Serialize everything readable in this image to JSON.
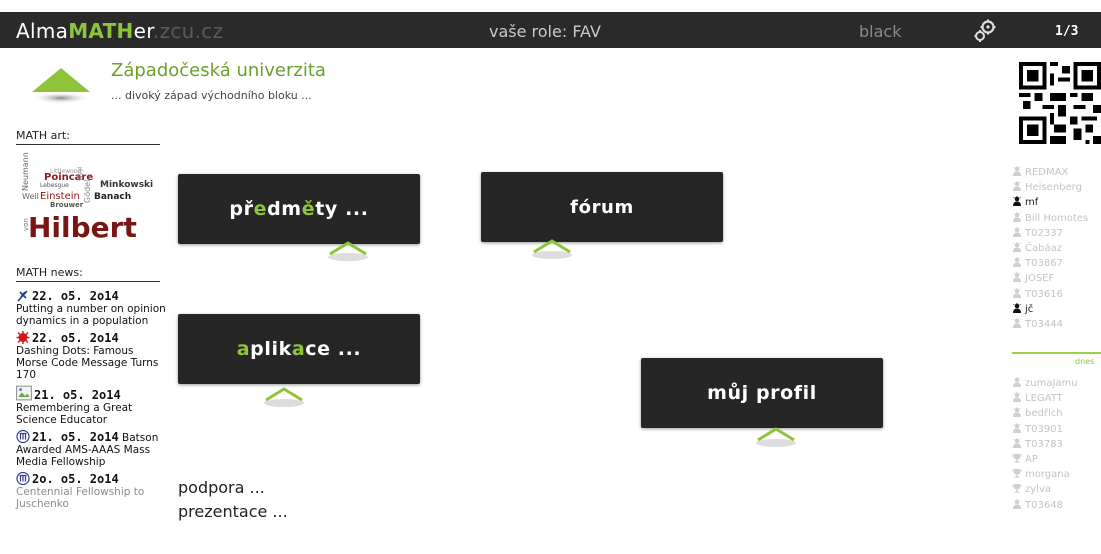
{
  "topbar": {
    "logo_alma": "Alma",
    "logo_math": "MATH",
    "logo_er": "er",
    "logo_domain": ".zcu.cz",
    "role": "vaše role: FAV",
    "theme": "black",
    "page": "1/3",
    "colors": {
      "bar": "#2a2a2a",
      "accent": "#8fc33a"
    }
  },
  "header": {
    "title": "Západočeská univerzita",
    "subtitle": "... divoký západ východního bloku ..."
  },
  "left": {
    "math_art_label": "MATH art:",
    "math_news_label": "MATH news:",
    "news": [
      {
        "icon": "feather-icon",
        "date": "22. o5. 2o14",
        "text": "Putting a number on opinion dynamics in a population"
      },
      {
        "icon": "red-star-icon",
        "date": "22. o5. 2o14",
        "text": "Dashing Dots: Famous Morse Code Message Turns 170"
      },
      {
        "icon": "broken-image-icon",
        "date": "21. o5. 2o14",
        "text": "Remembering a Great Science Educator"
      },
      {
        "icon": "institution-icon",
        "date": "21. o5. 2o14",
        "text": "Batson Awarded AMS-AAAS Mass Media Fellowship"
      },
      {
        "icon": "institution-icon",
        "date": "2o. o5. 2o14",
        "text": "Centennial Fellowship to Juschenko"
      }
    ]
  },
  "tiles": {
    "predmety": "předměty ...",
    "forum": "fórum",
    "aplikace": "aplikace ...",
    "profil": "můj profil"
  },
  "links": {
    "podpora": "podpora ...",
    "prezentace": "prezentace ..."
  },
  "right": {
    "users_top": [
      {
        "name": "REDMAX",
        "online": false
      },
      {
        "name": "Heisenberg",
        "online": false
      },
      {
        "name": "mf",
        "online": true
      },
      {
        "name": "Bill Homotes",
        "online": false
      },
      {
        "name": "T02337",
        "online": false
      },
      {
        "name": "Čabáaz",
        "online": false
      },
      {
        "name": "T03867",
        "online": false
      },
      {
        "name": "JOSEF",
        "online": false
      },
      {
        "name": "T03616",
        "online": false
      },
      {
        "name": "jč",
        "online": true
      },
      {
        "name": "T03444",
        "online": false
      }
    ],
    "dnes_label": "dnes",
    "users_bottom": [
      {
        "name": "zumaJamu",
        "icon": "person"
      },
      {
        "name": "LEGATT",
        "icon": "person"
      },
      {
        "name": "bedřich",
        "icon": "person"
      },
      {
        "name": "T03901",
        "icon": "person"
      },
      {
        "name": "T03783",
        "icon": "person"
      },
      {
        "name": "AP",
        "icon": "trophy"
      },
      {
        "name": "morgana",
        "icon": "trophy"
      },
      {
        "name": "zylva",
        "icon": "trophy"
      },
      {
        "name": "T03648",
        "icon": "person"
      }
    ]
  }
}
